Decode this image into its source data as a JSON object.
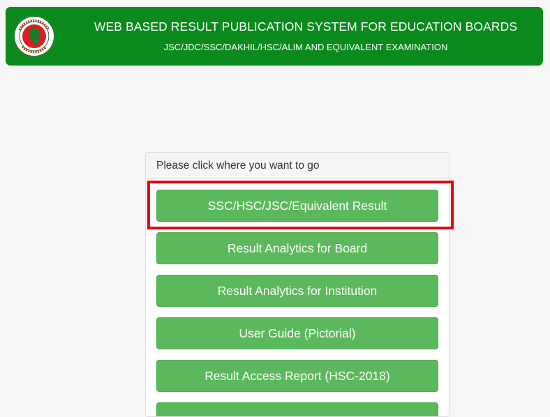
{
  "header": {
    "title": "WEB BASED RESULT PUBLICATION SYSTEM FOR EDUCATION BOARDS",
    "subtitle": "JSC/JDC/SSC/DAKHIL/HSC/ALIM AND EQUIVALENT EXAMINATION",
    "logo_icon": "government-seal-icon"
  },
  "panel": {
    "heading": "Please click where you want to go",
    "buttons": [
      "SSC/HSC/JSC/Equivalent Result",
      "Result Analytics for Board",
      "Result Analytics for Institution",
      "User Guide (Pictorial)",
      "Result Access Report (HSC-2018)",
      ""
    ]
  },
  "colors": {
    "header_green": "#0a8a1c",
    "button_green": "#5cb85c",
    "highlight_red": "#e8000f"
  }
}
